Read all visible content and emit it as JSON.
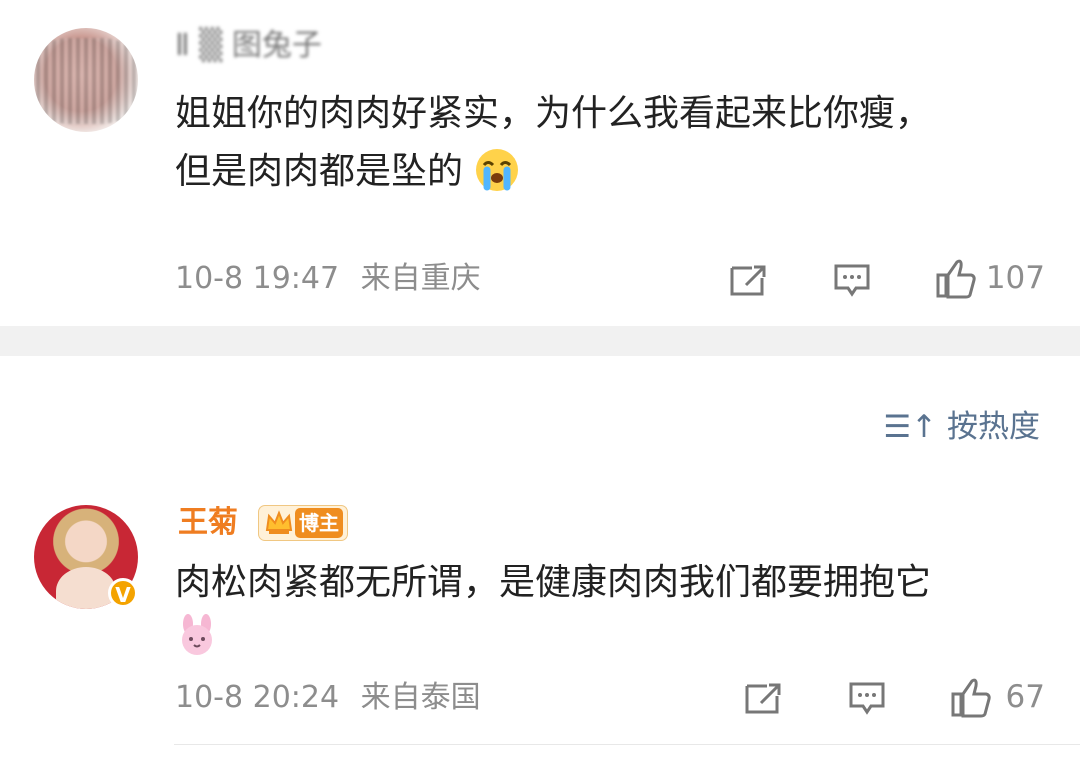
{
  "comments": [
    {
      "username": "Ⅱ ▒ 图兔子",
      "text_line1": "姐姐你的肉肉好紧实，为什么我看起来比你瘦，",
      "text_line2": "但是肉肉都是坠的",
      "emoji": "crying-face-icon",
      "date": "10-8 19:47",
      "location": "来自重庆",
      "like_count": "107"
    },
    {
      "username": "王菊",
      "badge": "博主",
      "verified_mark": "V",
      "text_line1": "肉松肉紧都无所谓，是健康肉肉我们都要拥抱它",
      "emoji": "pink-bunny-face-icon",
      "date": "10-8 20:24",
      "location": "来自泰国",
      "like_count": "67"
    }
  ],
  "sort": {
    "label": "按热度",
    "icon": "sort-icon"
  },
  "colors": {
    "author_name": "#ef7d21",
    "meta": "#8d8d8d",
    "sort_text": "#5a7390",
    "divider": "#f1f1f1"
  }
}
